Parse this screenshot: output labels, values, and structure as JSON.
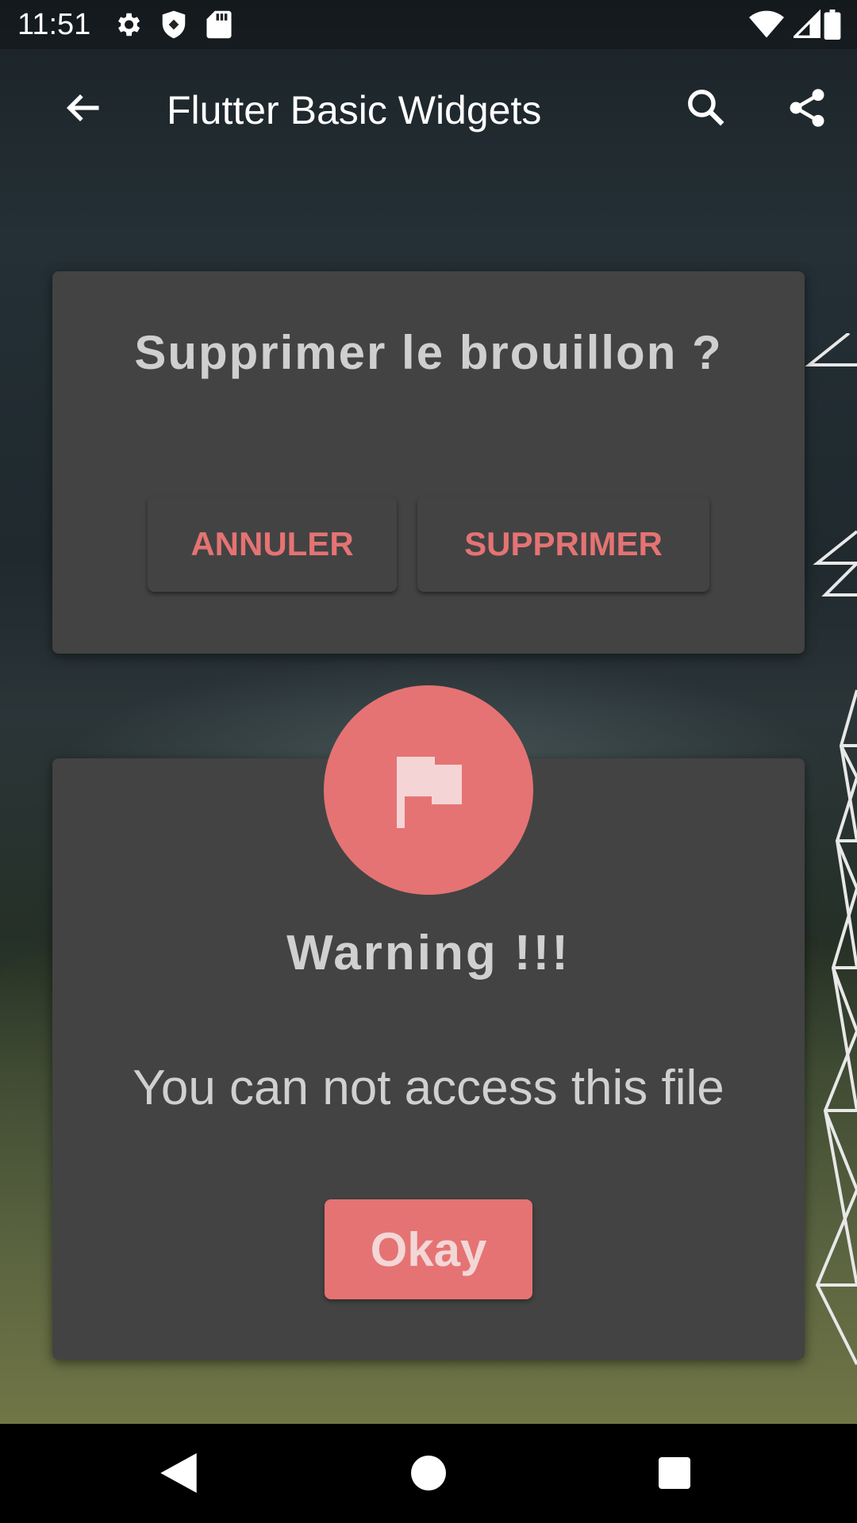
{
  "status_bar": {
    "time": "11:51",
    "left_icons": [
      "settings-icon",
      "shield-icon",
      "sd-card-icon"
    ],
    "right_icons": [
      "wifi-icon",
      "signal-icon",
      "battery-icon"
    ]
  },
  "app_bar": {
    "title": "Flutter Basic Widgets",
    "back_icon": "arrow-back-icon",
    "actions": [
      "search-icon",
      "share-icon"
    ]
  },
  "dialog_delete": {
    "title": "Supprimer le brouillon ?",
    "cancel_label": "ANNULER",
    "delete_label": "SUPPRIMER"
  },
  "dialog_warning": {
    "badge_icon": "flag-icon",
    "title": "Warning !!!",
    "message": "You can not access this file",
    "okay_label": "Okay"
  },
  "nav_bar": {
    "buttons": [
      "back-triangle-icon",
      "home-circle-icon",
      "recents-square-icon"
    ]
  },
  "colors": {
    "accent": "#e57373",
    "card": "#434343",
    "text_light": "#d0d0d0"
  }
}
